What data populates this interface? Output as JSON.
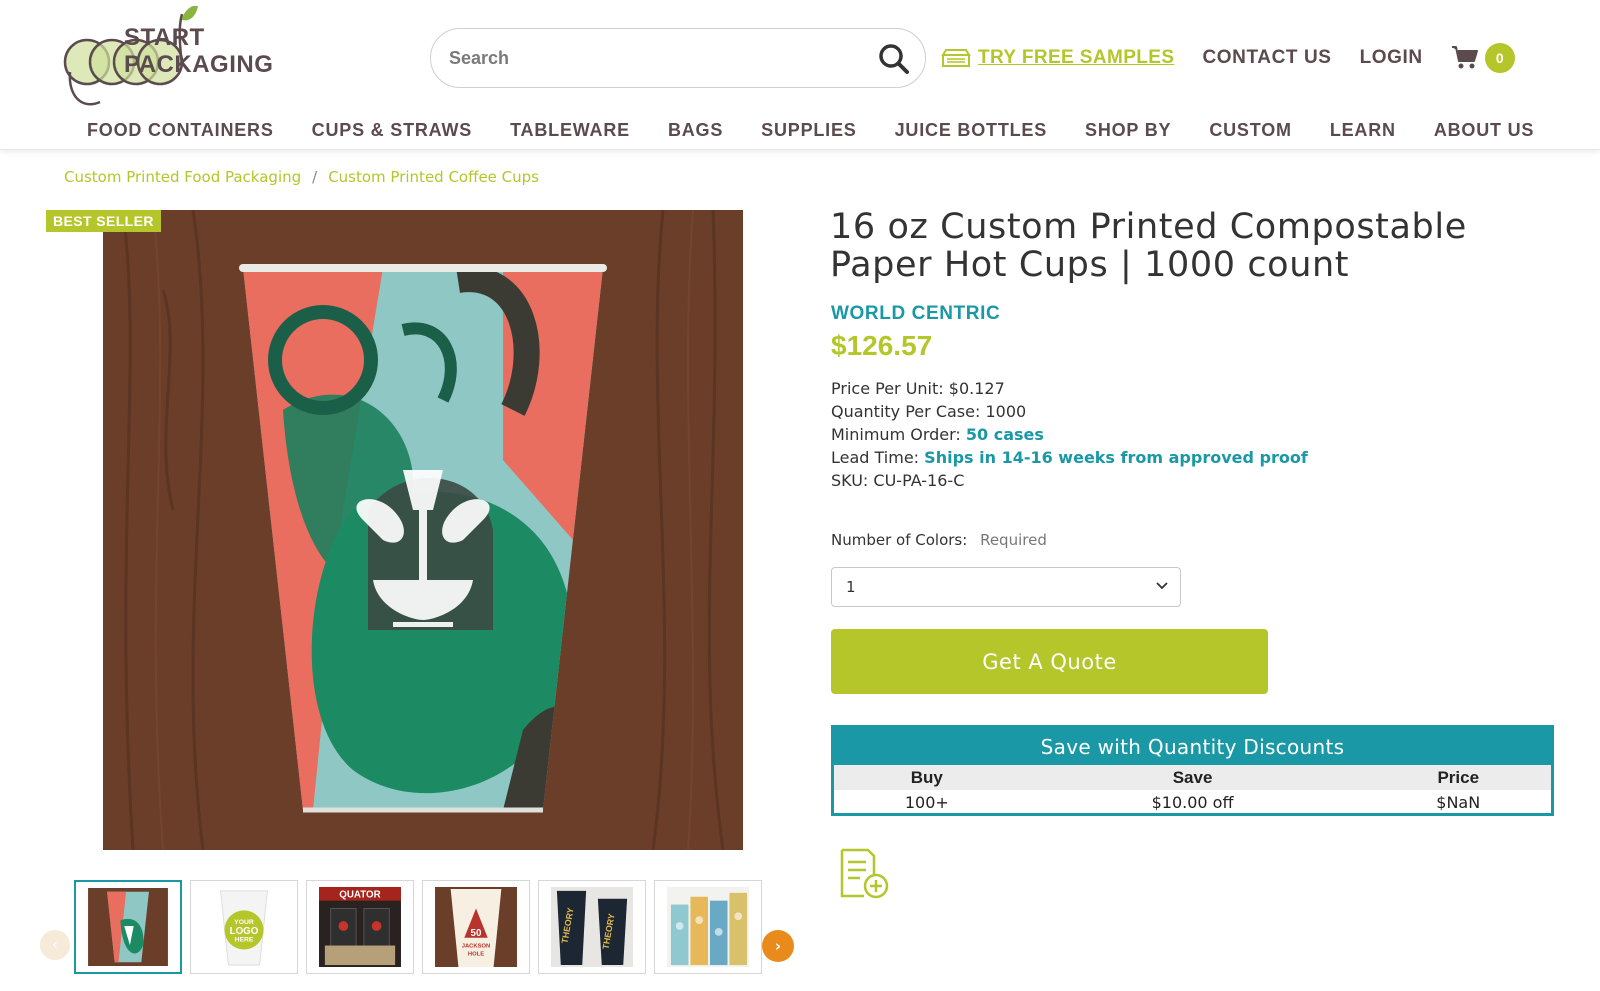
{
  "header": {
    "logo_words": [
      "START",
      "PACKAGING"
    ],
    "search_placeholder": "Search",
    "samples_label": "TRY FREE SAMPLES",
    "contact_label": "CONTACT US",
    "login_label": "LOGIN",
    "cart_count": "0"
  },
  "nav": [
    "FOOD CONTAINERS",
    "CUPS & STRAWS",
    "TABLEWARE",
    "BAGS",
    "SUPPLIES",
    "JUICE BOTTLES",
    "SHOP BY",
    "CUSTOM",
    "LEARN",
    "ABOUT US"
  ],
  "breadcrumb": {
    "items": [
      "Custom Printed Food Packaging",
      "Custom Printed Coffee Cups"
    ],
    "separator": "/"
  },
  "gallery": {
    "badge": "BEST SELLER",
    "thumb_logo_text": [
      "YOUR",
      "LOGO",
      "HERE"
    ],
    "thumb_text_equator": "QUATOR",
    "thumb_text_50": "50",
    "thumb_text_jackson": "JACKSON",
    "thumb_text_hole": "HOLE",
    "thumb_text_theory": "THEORY",
    "thumbnails": [
      "thumb-1",
      "thumb-2",
      "thumb-3",
      "thumb-4",
      "thumb-5",
      "thumb-6"
    ]
  },
  "product": {
    "title": "16 oz Custom Printed Compostable Paper Hot Cups | 1000 count",
    "brand": "WORLD CENTRIC",
    "price": "$126.57",
    "specs": {
      "price_per_unit_label": "Price Per Unit:",
      "price_per_unit": "$0.127",
      "qty_label": "Quantity Per Case:",
      "qty": "1000",
      "min_label": "Minimum Order:",
      "min": "50 cases",
      "lead_label": "Lead Time:",
      "lead": "Ships in 14-16 weeks from approved proof",
      "sku_label": "SKU:",
      "sku": "CU-PA-16-C"
    },
    "option_label": "Number of Colors:",
    "option_required": "Required",
    "option_value": "1",
    "quote_label": "Get A Quote"
  },
  "discount": {
    "title": "Save with Quantity Discounts",
    "columns": [
      "Buy",
      "Save",
      "Price"
    ],
    "rows": [
      [
        "100+",
        "$10.00 off",
        "$NaN"
      ]
    ]
  },
  "colors": {
    "brand_green": "#b4c62a",
    "brand_teal": "#1a98a6",
    "text_brown": "#5b4a4e",
    "slider_orange": "#e88b1c"
  },
  "icons": [
    "search-icon",
    "sample-box-icon",
    "cart-icon",
    "chevron-down-icon",
    "add-to-list-icon",
    "arrow-left-icon",
    "arrow-right-icon"
  ]
}
